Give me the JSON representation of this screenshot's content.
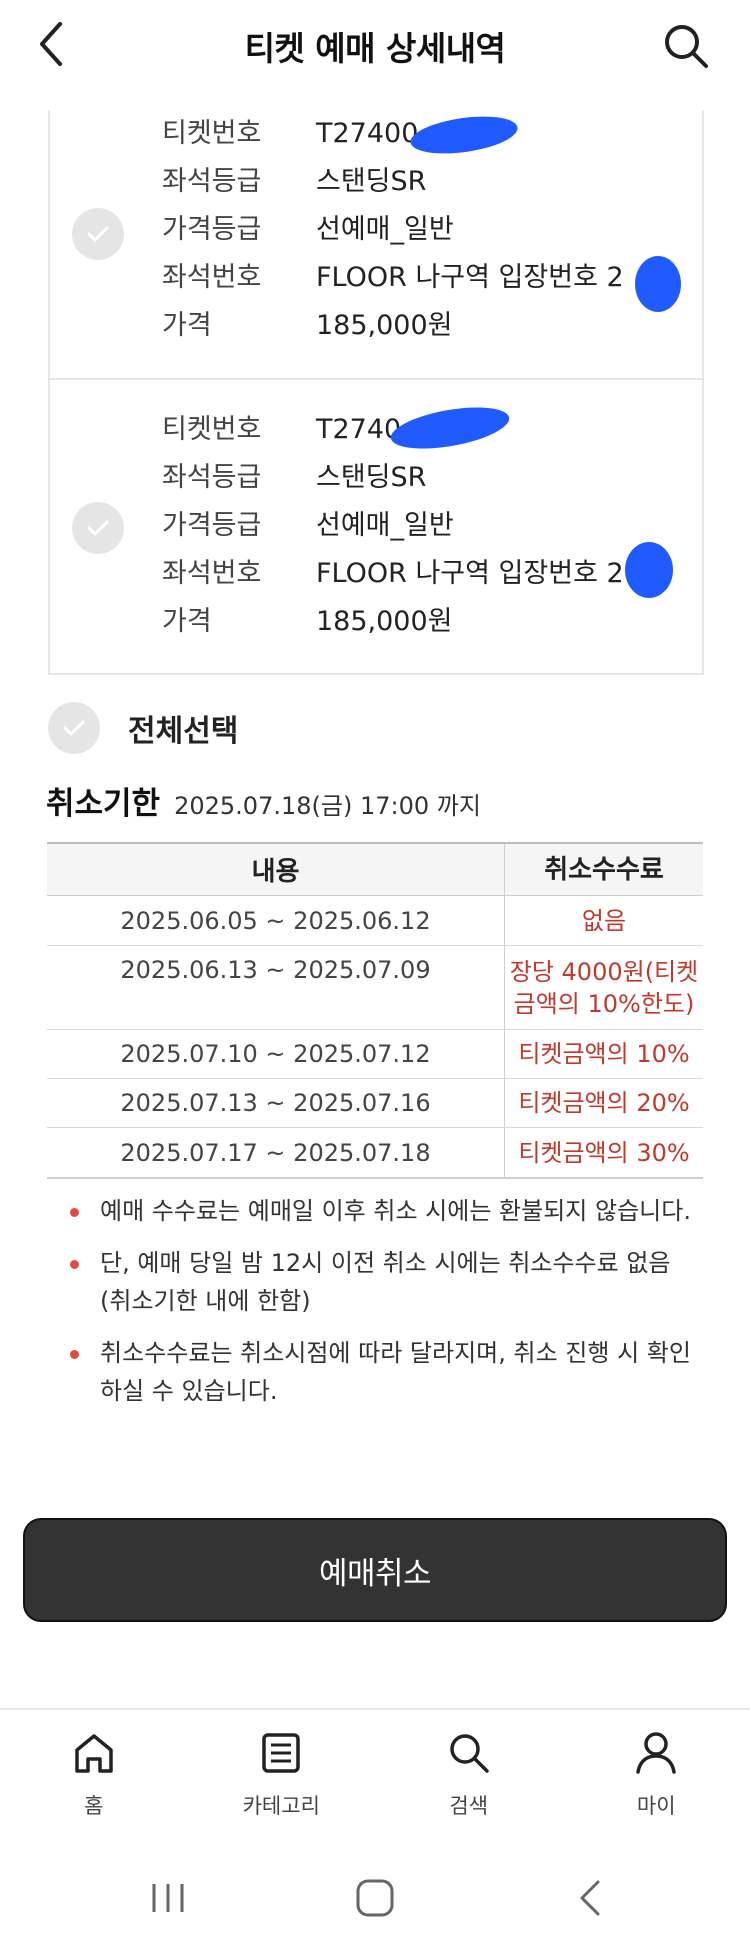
{
  "header": {
    "title": "티켓 예매 상세내역"
  },
  "tickets": [
    {
      "number_label": "티켓번호",
      "number_value": "T27400",
      "grade_label": "좌석등급",
      "grade_value": "스탠딩SR",
      "price_grade_label": "가격등급",
      "price_grade_value": "선예매_일반",
      "seat_label": "좌석번호",
      "seat_value": "FLOOR 나구역 입장번호 2",
      "price_label": "가격",
      "price_value": "185,000원"
    },
    {
      "number_label": "티켓번호",
      "number_value": "T2740",
      "grade_label": "좌석등급",
      "grade_value": "스탠딩SR",
      "price_grade_label": "가격등급",
      "price_grade_value": "선예매_일반",
      "seat_label": "좌석번호",
      "seat_value": "FLOOR 나구역 입장번호 2",
      "price_label": "가격",
      "price_value": "185,000원"
    }
  ],
  "select_all": {
    "label": "전체선택"
  },
  "deadline": {
    "label": "취소기한",
    "value": "2025.07.18(금) 17:00 까지"
  },
  "fee_table": {
    "headers": [
      "내용",
      "취소수수료"
    ],
    "rows": [
      {
        "period": "2025.06.05 ~ 2025.06.12",
        "fee": "없음"
      },
      {
        "period": "2025.06.13 ~ 2025.07.09",
        "fee": "장당 4000원(티켓금액의 10%한도)"
      },
      {
        "period": "2025.07.10 ~ 2025.07.12",
        "fee": "티켓금액의 10%"
      },
      {
        "period": "2025.07.13 ~ 2025.07.16",
        "fee": "티켓금액의 20%"
      },
      {
        "period": "2025.07.17 ~ 2025.07.18",
        "fee": "티켓금액의 30%"
      }
    ]
  },
  "notes": [
    "예매 수수료는 예매일 이후 취소 시에는 환불되지 않습니다.",
    "단, 예매 당일 밤 12시 이전 취소 시에는 취소수수료 없음 (취소기한 내에 한함)",
    "취소수수료는 취소시점에 따라 달라지며, 취소 진행 시 확인 하실 수 있습니다."
  ],
  "cancel_button": {
    "label": "예매취소"
  },
  "bottom_nav": [
    {
      "label": "홈",
      "icon": "home-icon"
    },
    {
      "label": "카테고리",
      "icon": "list-icon"
    },
    {
      "label": "검색",
      "icon": "search-icon"
    },
    {
      "label": "마이",
      "icon": "user-icon"
    }
  ],
  "colors": {
    "accent_red": "#c0392b",
    "button_dark": "#333333",
    "redaction_blue": "#1f5bff"
  }
}
